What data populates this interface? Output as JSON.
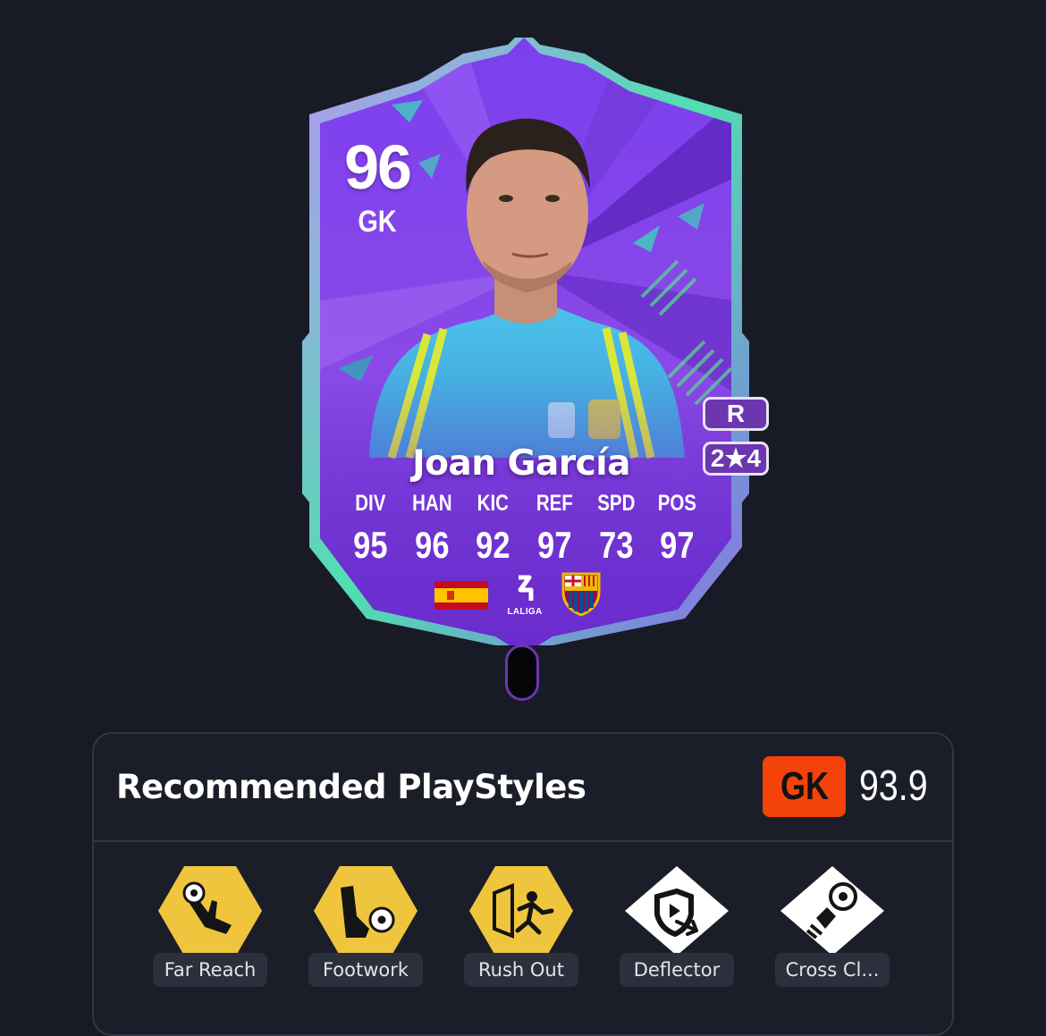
{
  "card": {
    "rating": "96",
    "position": "GK",
    "name": "Joan García",
    "preferred_foot": "R",
    "skill_weak": "2★4",
    "stats": [
      {
        "label": "DIV",
        "value": "95"
      },
      {
        "label": "HAN",
        "value": "96"
      },
      {
        "label": "KIC",
        "value": "92"
      },
      {
        "label": "REF",
        "value": "97"
      },
      {
        "label": "SPD",
        "value": "73"
      },
      {
        "label": "POS",
        "value": "97"
      }
    ],
    "nation_icon": "spain-flag-icon",
    "league_icon": "laliga-icon",
    "league_label": "LALIGA",
    "club_icon": "fc-barcelona-crest-icon",
    "colors": {
      "accent": "#7b2fe0",
      "frame": "#3fe0a0",
      "pill": "#6b36b0"
    }
  },
  "playstyles": {
    "title": "Recommended PlayStyles",
    "position": "GK",
    "score": "93.9",
    "badge_color": "#f3420a",
    "items": [
      {
        "label": "Far Reach",
        "icon": "far-reach-icon",
        "tier": "gold"
      },
      {
        "label": "Footwork",
        "icon": "footwork-icon",
        "tier": "gold"
      },
      {
        "label": "Rush Out",
        "icon": "rush-out-icon",
        "tier": "gold"
      },
      {
        "label": "Deflector",
        "icon": "deflector-icon",
        "tier": "white"
      },
      {
        "label": "Cross Cl...",
        "icon": "cross-claimer-icon",
        "tier": "white"
      }
    ]
  }
}
